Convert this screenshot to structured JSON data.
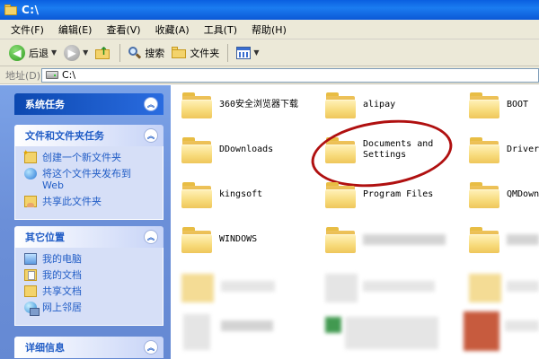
{
  "window": {
    "title": "C:\\"
  },
  "menu": [
    "文件(F)",
    "编辑(E)",
    "查看(V)",
    "收藏(A)",
    "工具(T)",
    "帮助(H)"
  ],
  "toolbar": {
    "back_label": "后退",
    "search_label": "搜索",
    "folders_label": "文件夹"
  },
  "address": {
    "label": "地址(D)",
    "value": "C:\\"
  },
  "tasks": {
    "system": {
      "title": "系统任务"
    },
    "file_folder": {
      "title": "文件和文件夹任务",
      "items": [
        "创建一个新文件夹",
        "将这个文件夹发布到 Web",
        "共享此文件夹"
      ]
    },
    "other_places": {
      "title": "其它位置",
      "items": [
        "我的电脑",
        "我的文档",
        "共享文档",
        "网上邻居"
      ]
    },
    "details": {
      "title": "详细信息"
    }
  },
  "folders": [
    "360安全浏览器下载",
    "alipay",
    "BOOT",
    "DDownloads",
    "Documents and Settings",
    "Drivers",
    "kingsoft",
    "Program Files",
    "QMDownl",
    "WINDOWS"
  ],
  "colors": {
    "titlebar": "#0a5fe0",
    "taskpane": "#7ba2e7",
    "link": "#215dc6",
    "highlight_ring": "#b01010"
  }
}
